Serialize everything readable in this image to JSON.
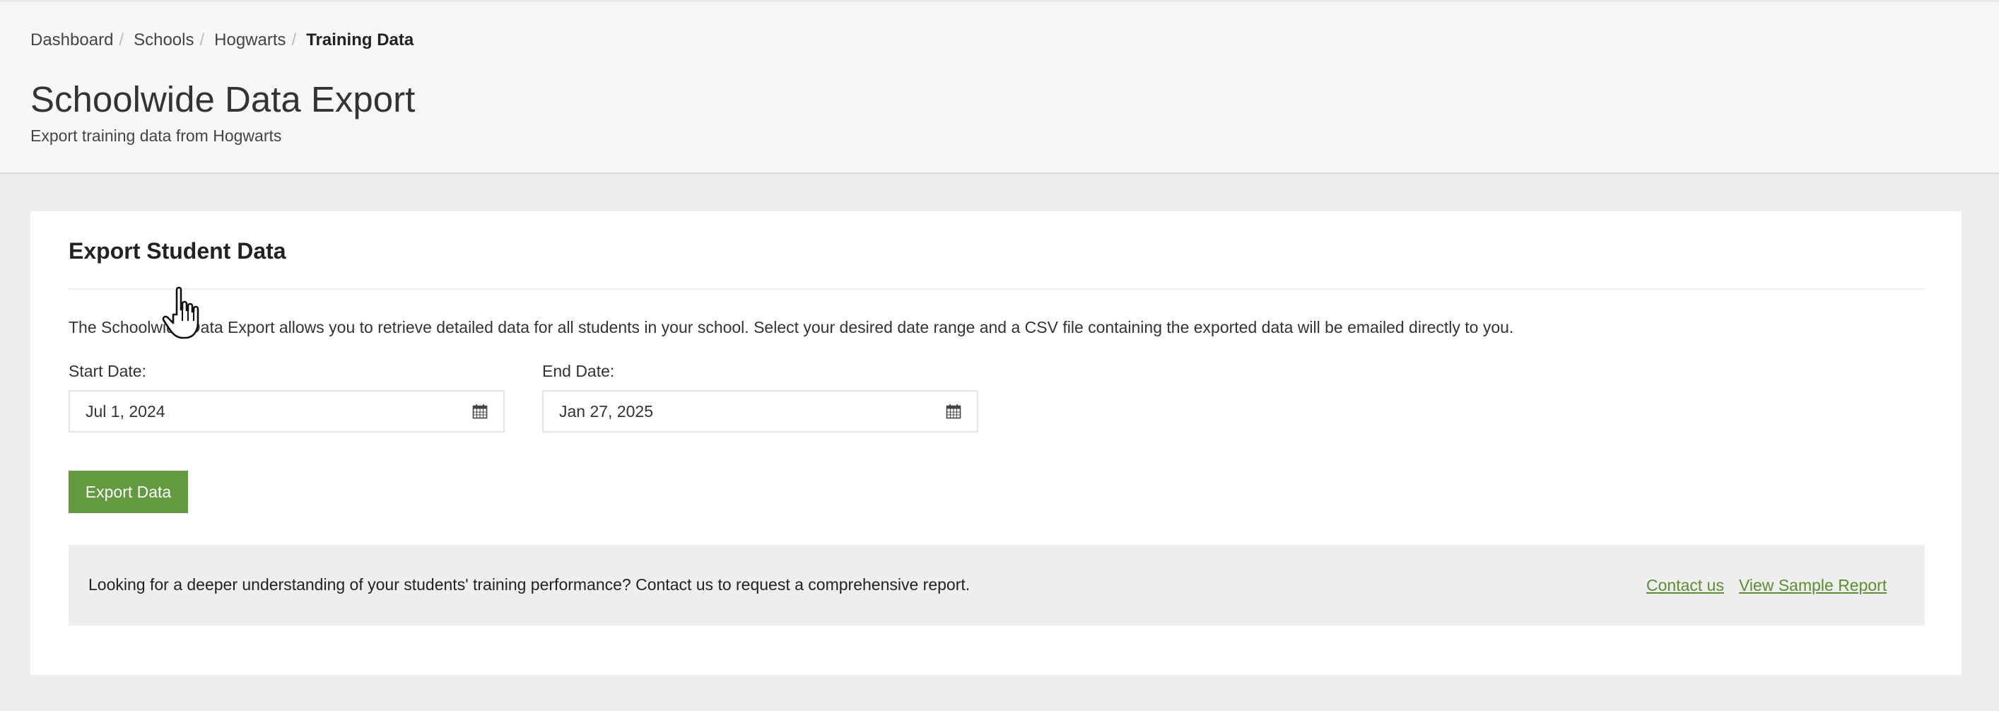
{
  "breadcrumb": {
    "items": [
      {
        "label": "Dashboard"
      },
      {
        "label": "Schools"
      },
      {
        "label": "Hogwarts"
      }
    ],
    "current": "Training Data"
  },
  "header": {
    "title": "Schoolwide Data Export",
    "subtitle": "Export training data from Hogwarts"
  },
  "panel": {
    "title": "Export Student Data",
    "description": "The Schoolwide Data Export allows you to retrieve detailed data for all students in your school. Select your desired date range and a CSV file containing the exported data will be emailed directly to you.",
    "start_date": {
      "label": "Start Date:",
      "value": "Jul 1, 2024",
      "icon": "calendar-icon"
    },
    "end_date": {
      "label": "End Date:",
      "value": "Jan 27, 2025",
      "icon": "calendar-icon"
    },
    "export_button": "Export Data"
  },
  "promo": {
    "text": "Looking for a deeper understanding of your students' training performance? Contact us to request a comprehensive report.",
    "contact_link": "Contact us",
    "sample_link": "View Sample Report"
  },
  "colors": {
    "accent": "#629a3f",
    "link": "#5b8f2e",
    "page_background": "#eeeeee",
    "header_background": "#f7f7f7"
  }
}
